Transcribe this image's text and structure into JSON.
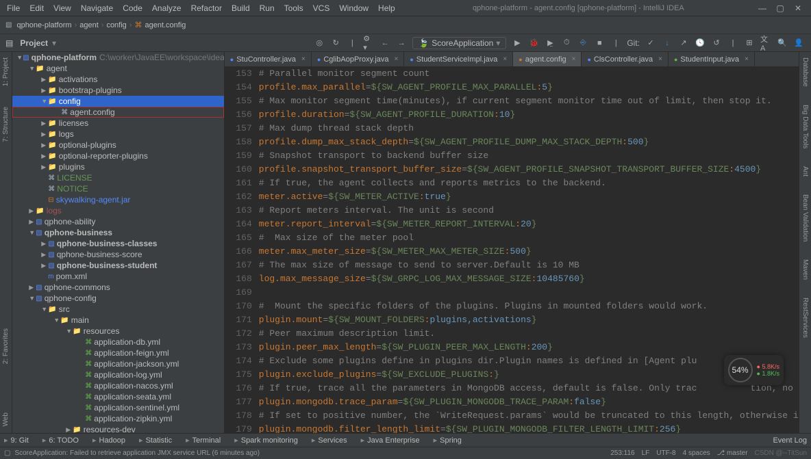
{
  "window": {
    "title": "qphone-platform - agent.config [qphone-platform] - IntelliJ IDEA",
    "menu": [
      "File",
      "Edit",
      "View",
      "Navigate",
      "Code",
      "Analyze",
      "Refactor",
      "Build",
      "Run",
      "Tools",
      "VCS",
      "Window",
      "Help"
    ]
  },
  "breadcrumb": [
    "qphone-platform",
    "agent",
    "config",
    "agent.config"
  ],
  "run_config": "ScoreApplication",
  "git_label": "Git:",
  "project_label": "Project",
  "tree": {
    "root": {
      "name": "qphone-platform",
      "hint": "C:\\worker\\JavaEE\\workspace\\idea_workspace\\qph"
    },
    "items": [
      {
        "pad": 24,
        "arrow": "▼",
        "ic": "fold",
        "name": "agent"
      },
      {
        "pad": 42,
        "arrow": "▶",
        "ic": "fold",
        "name": "activations"
      },
      {
        "pad": 42,
        "arrow": "▶",
        "ic": "fold",
        "name": "bootstrap-plugins"
      },
      {
        "pad": 42,
        "arrow": "▼",
        "ic": "fold",
        "name": "config",
        "sel": true
      },
      {
        "pad": 60,
        "arrow": "",
        "ic": "file",
        "name": "agent.config",
        "boxed": true
      },
      {
        "pad": 42,
        "arrow": "▶",
        "ic": "fold",
        "name": "licenses"
      },
      {
        "pad": 42,
        "arrow": "▶",
        "ic": "fold",
        "name": "logs"
      },
      {
        "pad": 42,
        "arrow": "▶",
        "ic": "fold",
        "name": "optional-plugins"
      },
      {
        "pad": 42,
        "arrow": "▶",
        "ic": "fold",
        "name": "optional-reporter-plugins"
      },
      {
        "pad": 42,
        "arrow": "▶",
        "ic": "fold",
        "name": "plugins"
      },
      {
        "pad": 42,
        "arrow": "",
        "ic": "file",
        "name": "LICENSE",
        "color": "#629755"
      },
      {
        "pad": 42,
        "arrow": "",
        "ic": "file",
        "name": "NOTICE",
        "color": "#629755"
      },
      {
        "pad": 42,
        "arrow": "",
        "ic": "jar",
        "name": "skywalking-agent.jar",
        "color": "#548af7"
      },
      {
        "pad": 24,
        "arrow": "▶",
        "ic": "fold",
        "name": "logs",
        "color": "#a35252"
      },
      {
        "pad": 24,
        "arrow": "▶",
        "ic": "mod",
        "name": "qphone-ability"
      },
      {
        "pad": 24,
        "arrow": "▼",
        "ic": "mod",
        "name": "qphone-business",
        "bold": true
      },
      {
        "pad": 42,
        "arrow": "▶",
        "ic": "mod",
        "name": "qphone-business-classes",
        "bold": true
      },
      {
        "pad": 42,
        "arrow": "▶",
        "ic": "mod",
        "name": "qphone-business-score"
      },
      {
        "pad": 42,
        "arrow": "▶",
        "ic": "mod",
        "name": "qphone-business-student",
        "bold": true
      },
      {
        "pad": 42,
        "arrow": "",
        "ic": "xml",
        "name": "pom.xml"
      },
      {
        "pad": 24,
        "arrow": "▶",
        "ic": "mod",
        "name": "qphone-commons"
      },
      {
        "pad": 24,
        "arrow": "▼",
        "ic": "mod",
        "name": "qphone-config"
      },
      {
        "pad": 42,
        "arrow": "▼",
        "ic": "fold",
        "name": "src"
      },
      {
        "pad": 60,
        "arrow": "▼",
        "ic": "fold",
        "name": "main"
      },
      {
        "pad": 78,
        "arrow": "▼",
        "ic": "fold",
        "name": "resources"
      },
      {
        "pad": 96,
        "arrow": "",
        "ic": "yml",
        "name": "application-db.yml"
      },
      {
        "pad": 96,
        "arrow": "",
        "ic": "yml",
        "name": "application-feign.yml"
      },
      {
        "pad": 96,
        "arrow": "",
        "ic": "yml",
        "name": "application-jackson.yml"
      },
      {
        "pad": 96,
        "arrow": "",
        "ic": "yml",
        "name": "application-log.yml"
      },
      {
        "pad": 96,
        "arrow": "",
        "ic": "yml",
        "name": "application-nacos.yml"
      },
      {
        "pad": 96,
        "arrow": "",
        "ic": "yml",
        "name": "application-seata.yml"
      },
      {
        "pad": 96,
        "arrow": "",
        "ic": "yml",
        "name": "application-sentinel.yml"
      },
      {
        "pad": 96,
        "arrow": "",
        "ic": "yml",
        "name": "application-zipkin.yml"
      },
      {
        "pad": 78,
        "arrow": "▶",
        "ic": "fold",
        "name": "resources-dev"
      }
    ]
  },
  "tabs": [
    {
      "label": "StuController.java",
      "icon": "c",
      "cls": "ti-blue"
    },
    {
      "label": "CglibAopProxy.java",
      "icon": "c",
      "cls": "ti-blue"
    },
    {
      "label": "StudentServiceImpl.java",
      "icon": "c",
      "cls": "ti-blue"
    },
    {
      "label": "agent.config",
      "icon": "⌘",
      "cls": "ti-orange",
      "active": true
    },
    {
      "label": "ClsController.java",
      "icon": "c",
      "cls": "ti-blue"
    },
    {
      "label": "StudentInput.java",
      "icon": "c",
      "cls": "ti-green"
    }
  ],
  "code": {
    "start": 153,
    "lines": [
      {
        "t": "cmt",
        "text": "# Parallel monitor segment count"
      },
      {
        "t": "kv",
        "key": "profile.max_parallel",
        "var": "SW_AGENT_PROFILE_MAX_PARALLEL",
        "def": "5"
      },
      {
        "t": "cmt",
        "text": "# Max monitor segment time(minutes), if current segment monitor time out of limit, then stop it."
      },
      {
        "t": "kv",
        "key": "profile.duration",
        "var": "SW_AGENT_PROFILE_DURATION",
        "def": "10"
      },
      {
        "t": "cmt",
        "text": "# Max dump thread stack depth"
      },
      {
        "t": "kv",
        "key": "profile.dump_max_stack_depth",
        "var": "SW_AGENT_PROFILE_DUMP_MAX_STACK_DEPTH",
        "def": "500"
      },
      {
        "t": "cmt",
        "text": "# Snapshot transport to backend buffer size"
      },
      {
        "t": "kv",
        "key": "profile.snapshot_transport_buffer_size",
        "var": "SW_AGENT_PROFILE_SNAPSHOT_TRANSPORT_BUFFER_SIZE",
        "def": "4500"
      },
      {
        "t": "cmt",
        "text": "# If true, the agent collects and reports metrics to the backend."
      },
      {
        "t": "kv",
        "key": "meter.active",
        "var": "SW_METER_ACTIVE",
        "def": "true"
      },
      {
        "t": "cmt",
        "text": "# Report meters interval. The unit is second"
      },
      {
        "t": "kv",
        "key": "meter.report_interval",
        "var": "SW_METER_REPORT_INTERVAL",
        "def": "20"
      },
      {
        "t": "cmt",
        "text": "#  Max size of the meter pool"
      },
      {
        "t": "kv",
        "key": "meter.max_meter_size",
        "var": "SW_METER_MAX_METER_SIZE",
        "def": "500"
      },
      {
        "t": "cmt",
        "text": "# The max size of message to send to server.Default is 10 MB"
      },
      {
        "t": "kv",
        "key": "log.max_message_size",
        "var": "SW_GRPC_LOG_MAX_MESSAGE_SIZE",
        "def": "10485760"
      },
      {
        "t": "blank",
        "text": ""
      },
      {
        "t": "cmt",
        "text": "#  Mount the specific folders of the plugins. Plugins in mounted folders would work."
      },
      {
        "t": "kv",
        "key": "plugin.mount",
        "var": "SW_MOUNT_FOLDERS",
        "def": "plugins,activations"
      },
      {
        "t": "cmt",
        "text": "# Peer maximum description limit."
      },
      {
        "t": "kv",
        "key": "plugin.peer_max_length",
        "var": "SW_PLUGIN_PEER_MAX_LENGTH",
        "def": "200"
      },
      {
        "t": "cmt",
        "text": "# Exclude some plugins define in plugins dir.Plugin names is defined in [Agent plu"
      },
      {
        "t": "kv",
        "key": "plugin.exclude_plugins",
        "var": "SW_EXCLUDE_PLUGINS",
        "def": ""
      },
      {
        "t": "cmt",
        "text": "# If true, trace all the parameters in MongoDB access, default is false. Only trac          tion, no"
      },
      {
        "t": "kv",
        "key": "plugin.mongodb.trace_param",
        "var": "SW_PLUGIN_MONGODB_TRACE_PARAM",
        "def": "false"
      },
      {
        "t": "cmt",
        "text": "# If set to positive number, the `WriteRequest.params` would be truncated to this length, otherwise i"
      },
      {
        "t": "kv",
        "key": "plugin.mongodb.filter_length_limit",
        "var": "SW_PLUGIN_MONGODB_FILTER_LENGTH_LIMIT",
        "def": "256"
      }
    ]
  },
  "bottom_tools": [
    "9: Git",
    "6: TODO",
    "Hadoop",
    "Statistic",
    "Terminal",
    "Spark monitoring",
    "Services",
    "Java Enterprise",
    "Spring"
  ],
  "right_tools": [
    "Event Log"
  ],
  "status": {
    "msg": "ScoreApplication: Failed to retrieve application JMX service URL (6 minutes ago)",
    "pos": "253:116",
    "eol": "LF",
    "enc": "UTF-8",
    "indent": "4 spaces",
    "branch": "master",
    "watermark": "CSDN @--TitSun"
  },
  "overlay": {
    "pct": "54%",
    "up": "5.8K/s",
    "down": "1.8K/s"
  }
}
